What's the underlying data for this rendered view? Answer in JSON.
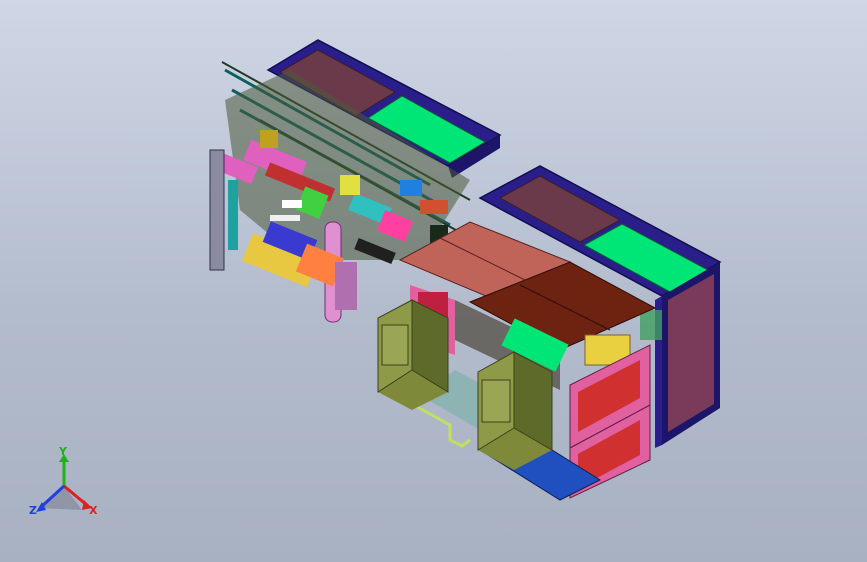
{
  "viewport": {
    "background_top": "#cfd7e6",
    "background_bottom": "#a8b1c2"
  },
  "model": {
    "description_visible": false,
    "colors": {
      "frame_blue": "#2a1f8a",
      "panel_maroon": "#6b3a4a",
      "screen_green": "#00e676",
      "lid_salmon": "#c0645a",
      "lid_dark": "#6e2210",
      "cabinet_olive": "#7e8a3a",
      "pink": "#e060c0",
      "red_panel": "#d03030",
      "yellow": "#e8d040",
      "floor_blue": "#2050c0"
    }
  },
  "triad": {
    "x_label": "X",
    "y_label": "Y",
    "z_label": "Z",
    "x_color": "#e02020",
    "y_color": "#20b020",
    "z_color": "#2040e0"
  }
}
